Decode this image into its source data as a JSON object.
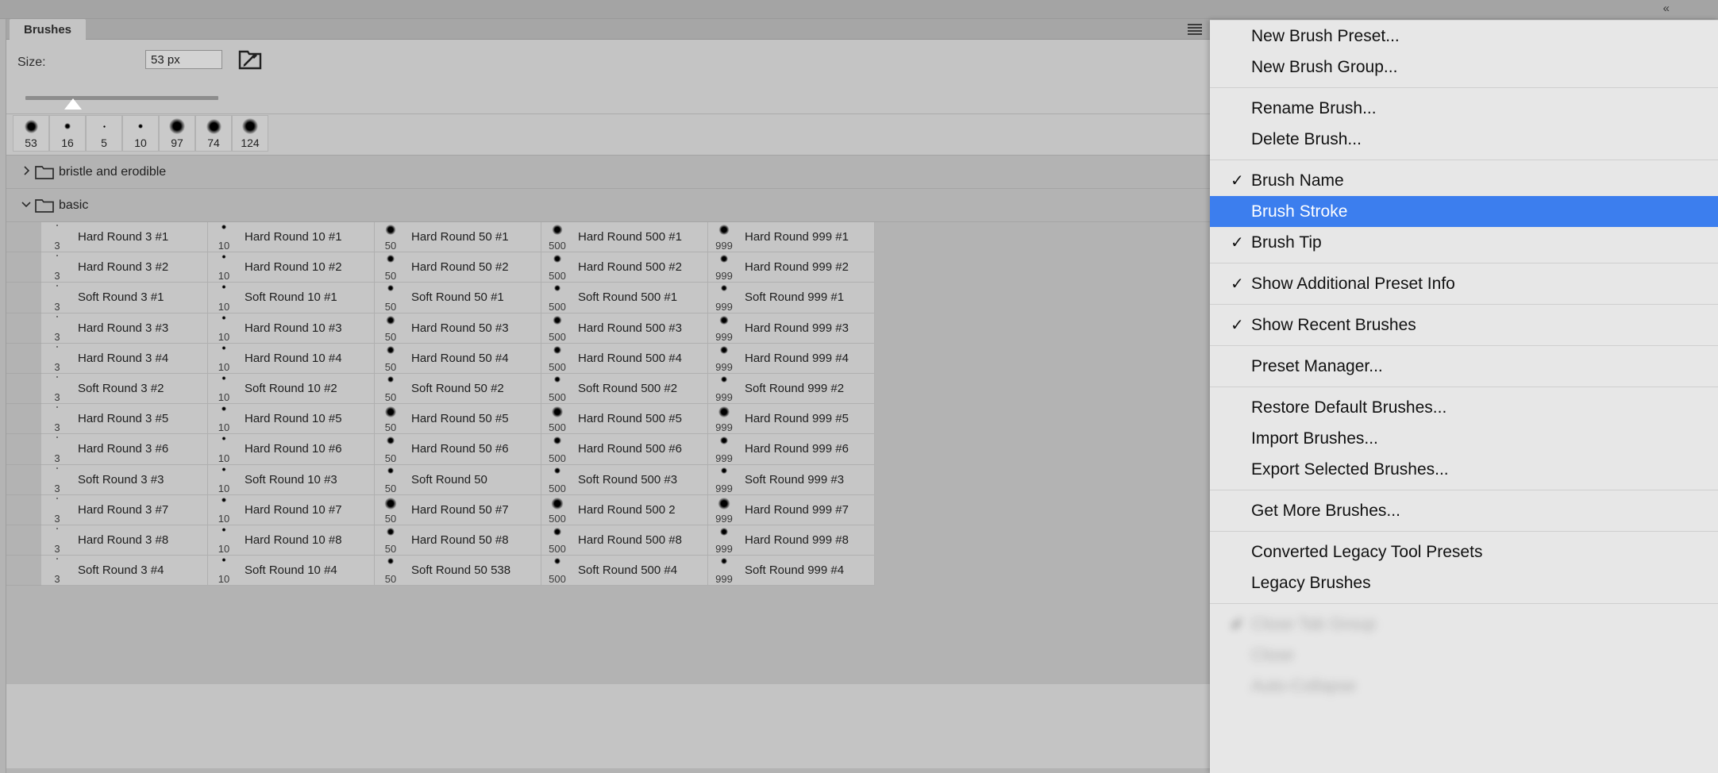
{
  "window": {
    "collapse_label": "«"
  },
  "panel": {
    "tab_label": "Brushes",
    "menu_icon": "hamburger-menu-icon",
    "size": {
      "label": "Size:",
      "value": "53 px",
      "placeholder": "53 px",
      "slider_percent": 24
    },
    "new_brush_icon": "brush-folder-icon"
  },
  "recent_brushes": {
    "items": [
      {
        "label": "53",
        "dot": 17
      },
      {
        "label": "16",
        "dot": 8
      },
      {
        "label": "5",
        "dot": 3
      },
      {
        "label": "10",
        "dot": 6
      },
      {
        "label": "97",
        "dot": 20
      },
      {
        "label": "74",
        "dot": 19
      },
      {
        "label": "124",
        "dot": 20
      }
    ]
  },
  "groups": [
    {
      "name": "bristle and erodible",
      "expanded": false,
      "twisty": "›"
    },
    {
      "name": "basic",
      "expanded": true,
      "twisty": "⌄"
    }
  ],
  "brush_grid": {
    "columns": [
      "3",
      "10",
      "50",
      "500",
      "999"
    ],
    "rows": [
      {
        "cells": [
          {
            "size": "3",
            "name": "Hard Round 3 #1",
            "dot": 2
          },
          {
            "size": "10",
            "name": "Hard Round 10 #1",
            "dot": 6
          },
          {
            "size": "50",
            "name": "Hard Round 50 #1",
            "dot": 13
          },
          {
            "size": "500",
            "name": "Hard Round 500 #1",
            "dot": 13
          },
          {
            "size": "999",
            "name": "Hard Round 999 #1",
            "dot": 13
          }
        ]
      },
      {
        "cells": [
          {
            "size": "3",
            "name": "Hard Round 3 #2",
            "dot": 2
          },
          {
            "size": "10",
            "name": "Hard Round 10 #2",
            "dot": 5
          },
          {
            "size": "50",
            "name": "Hard Round 50 #2",
            "dot": 10
          },
          {
            "size": "500",
            "name": "Hard Round 500 #2",
            "dot": 10
          },
          {
            "size": "999",
            "name": "Hard Round 999 #2",
            "dot": 10
          }
        ]
      },
      {
        "cells": [
          {
            "size": "3",
            "name": "Soft Round 3 #1",
            "dot": 2
          },
          {
            "size": "10",
            "name": "Soft Round 10 #1",
            "dot": 5
          },
          {
            "size": "50",
            "name": "Soft Round 50 #1",
            "dot": 8
          },
          {
            "size": "500",
            "name": "Soft Round 500 #1",
            "dot": 8
          },
          {
            "size": "999",
            "name": "Soft Round 999 #1",
            "dot": 8
          }
        ]
      },
      {
        "cells": [
          {
            "size": "3",
            "name": "Hard Round 3 #3",
            "dot": 2
          },
          {
            "size": "10",
            "name": "Hard Round 10 #3",
            "dot": 5
          },
          {
            "size": "50",
            "name": "Hard Round 50 #3",
            "dot": 11
          },
          {
            "size": "500",
            "name": "Hard Round 500 #3",
            "dot": 11
          },
          {
            "size": "999",
            "name": "Hard Round 999 #3",
            "dot": 11
          }
        ]
      },
      {
        "cells": [
          {
            "size": "3",
            "name": "Hard Round 3 #4",
            "dot": 2
          },
          {
            "size": "10",
            "name": "Hard Round 10 #4",
            "dot": 5
          },
          {
            "size": "50",
            "name": "Hard Round 50 #4",
            "dot": 10
          },
          {
            "size": "500",
            "name": "Hard Round 500 #4",
            "dot": 10
          },
          {
            "size": "999",
            "name": "Hard Round 999 #4",
            "dot": 10
          }
        ]
      },
      {
        "cells": [
          {
            "size": "3",
            "name": "Soft Round 3 #2",
            "dot": 2
          },
          {
            "size": "10",
            "name": "Soft Round 10 #2",
            "dot": 5
          },
          {
            "size": "50",
            "name": "Soft Round 50 #2",
            "dot": 8
          },
          {
            "size": "500",
            "name": "Soft Round 500 #2",
            "dot": 8
          },
          {
            "size": "999",
            "name": "Soft Round 999 #2",
            "dot": 8
          }
        ]
      },
      {
        "cells": [
          {
            "size": "3",
            "name": "Hard Round 3 #5",
            "dot": 2
          },
          {
            "size": "10",
            "name": "Hard Round 10 #5",
            "dot": 6
          },
          {
            "size": "50",
            "name": "Hard Round 50 #5",
            "dot": 14
          },
          {
            "size": "500",
            "name": "Hard Round 500 #5",
            "dot": 14
          },
          {
            "size": "999",
            "name": "Hard Round 999 #5",
            "dot": 14
          }
        ]
      },
      {
        "cells": [
          {
            "size": "3",
            "name": "Hard Round 3 #6",
            "dot": 2
          },
          {
            "size": "10",
            "name": "Hard Round 10 #6",
            "dot": 5
          },
          {
            "size": "50",
            "name": "Hard Round 50 #6",
            "dot": 10
          },
          {
            "size": "500",
            "name": "Hard Round 500 #6",
            "dot": 10
          },
          {
            "size": "999",
            "name": "Hard Round 999 #6",
            "dot": 10
          }
        ]
      },
      {
        "cells": [
          {
            "size": "3",
            "name": "Soft Round 3 #3",
            "dot": 2
          },
          {
            "size": "10",
            "name": "Soft Round 10 #3",
            "dot": 5
          },
          {
            "size": "50",
            "name": "Soft Round 50",
            "dot": 8
          },
          {
            "size": "500",
            "name": "Soft Round 500 #3",
            "dot": 8
          },
          {
            "size": "999",
            "name": "Soft Round 999 #3",
            "dot": 8
          }
        ]
      },
      {
        "cells": [
          {
            "size": "3",
            "name": "Hard Round 3 #7",
            "dot": 2
          },
          {
            "size": "10",
            "name": "Hard Round 10 #7",
            "dot": 6
          },
          {
            "size": "50",
            "name": "Hard Round 50 #7",
            "dot": 15
          },
          {
            "size": "500",
            "name": "Hard Round 500 2",
            "dot": 15
          },
          {
            "size": "999",
            "name": "Hard Round 999 #7",
            "dot": 15
          }
        ]
      },
      {
        "cells": [
          {
            "size": "3",
            "name": "Hard Round 3 #8",
            "dot": 2
          },
          {
            "size": "10",
            "name": "Hard Round 10 #8",
            "dot": 5
          },
          {
            "size": "50",
            "name": "Hard Round 50 #8",
            "dot": 10
          },
          {
            "size": "500",
            "name": "Hard Round 500 #8",
            "dot": 10
          },
          {
            "size": "999",
            "name": "Hard Round 999 #8",
            "dot": 10
          }
        ]
      },
      {
        "cells": [
          {
            "size": "3",
            "name": "Soft Round 3 #4",
            "dot": 2
          },
          {
            "size": "10",
            "name": "Soft Round 10 #4",
            "dot": 5
          },
          {
            "size": "50",
            "name": "Soft Round 50 538",
            "dot": 8
          },
          {
            "size": "500",
            "name": "Soft Round 500 #4",
            "dot": 8
          },
          {
            "size": "999",
            "name": "Soft Round 999 #4",
            "dot": 8
          }
        ]
      }
    ]
  },
  "flyout_menu": {
    "highlight_color": "#3c7eee",
    "items": [
      {
        "type": "item",
        "label": "New Brush Preset...",
        "checked": false,
        "selected": false
      },
      {
        "type": "item",
        "label": "New Brush Group...",
        "checked": false,
        "selected": false
      },
      {
        "type": "separator"
      },
      {
        "type": "item",
        "label": "Rename Brush...",
        "checked": false,
        "selected": false
      },
      {
        "type": "item",
        "label": "Delete Brush...",
        "checked": false,
        "selected": false
      },
      {
        "type": "separator"
      },
      {
        "type": "item",
        "label": "Brush Name",
        "checked": true,
        "selected": false
      },
      {
        "type": "item",
        "label": "Brush Stroke",
        "checked": false,
        "selected": true
      },
      {
        "type": "item",
        "label": "Brush Tip",
        "checked": true,
        "selected": false
      },
      {
        "type": "separator"
      },
      {
        "type": "item",
        "label": "Show Additional Preset Info",
        "checked": true,
        "selected": false
      },
      {
        "type": "separator"
      },
      {
        "type": "item",
        "label": "Show Recent Brushes",
        "checked": true,
        "selected": false
      },
      {
        "type": "separator"
      },
      {
        "type": "item",
        "label": "Preset Manager...",
        "checked": false,
        "selected": false
      },
      {
        "type": "separator"
      },
      {
        "type": "item",
        "label": "Restore Default Brushes...",
        "checked": false,
        "selected": false
      },
      {
        "type": "item",
        "label": "Import Brushes...",
        "checked": false,
        "selected": false
      },
      {
        "type": "item",
        "label": "Export Selected Brushes...",
        "checked": false,
        "selected": false
      },
      {
        "type": "separator"
      },
      {
        "type": "item",
        "label": "Get More Brushes...",
        "checked": false,
        "selected": false
      },
      {
        "type": "separator"
      },
      {
        "type": "item",
        "label": "Converted Legacy Tool Presets",
        "checked": false,
        "selected": false
      },
      {
        "type": "item",
        "label": "Legacy Brushes",
        "checked": false,
        "selected": false
      },
      {
        "type": "separator"
      },
      {
        "type": "item",
        "label": "Close Tab Group",
        "checked": true,
        "selected": false,
        "blurred": true
      },
      {
        "type": "item",
        "label": "Close",
        "checked": false,
        "selected": false,
        "blurred": true
      },
      {
        "type": "item",
        "label": "Auto-Collapse",
        "checked": false,
        "selected": false,
        "blurred": true
      }
    ]
  },
  "checkmark_glyph": "✓"
}
